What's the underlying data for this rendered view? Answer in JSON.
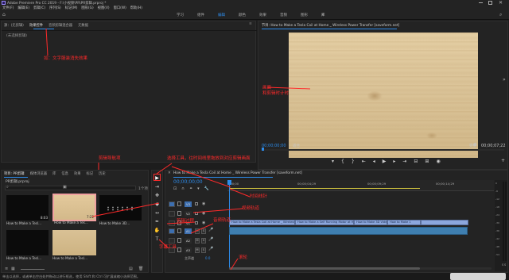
{
  "title_bar": {
    "title": "Adobe Premiere Pro CC 2019 - F:\\小视频\\PR\\PR剪辑.prproj *"
  },
  "menu_bar": {
    "items": [
      "文件(F)",
      "编辑(E)",
      "剪辑(C)",
      "序列(S)",
      "标记(M)",
      "图形(G)",
      "视图(V)",
      "窗口(W)",
      "帮助(H)"
    ]
  },
  "workspaces": {
    "items": [
      "学习",
      "组件",
      "编辑",
      "颜色",
      "效果",
      "音频",
      "图形",
      "库"
    ],
    "active_index": 2
  },
  "source_panel": {
    "tabs": [
      "源：(无剪辑)",
      "效果控件",
      "音频剪辑混合器",
      "元数据"
    ],
    "message": "(未选择剪辑)"
  },
  "program_monitor": {
    "title": "节目: How to Make a Tesla Coil at Home _ Wireless Power Transfer [saveform.net]",
    "timecode_left": "00;00;00;00",
    "fit_label": "适合",
    "quality_label": "完整",
    "timecode_right": "00;00;07;22"
  },
  "project_panel": {
    "tabs": [
      "项目: PR剪辑",
      "媒体浏览器",
      "库",
      "信息",
      "效果",
      "标记",
      "历史"
    ],
    "file_name": "PR剪辑.prproj",
    "item_count": "1个项",
    "items": [
      {
        "name": "How to Make a Tesl...",
        "duration": "8:03"
      },
      {
        "name": "How to Make a Tes...",
        "duration": "7:22"
      },
      {
        "name": "How to Make 3D...",
        "duration": ""
      },
      {
        "name": "How to Make a Tesl...",
        "duration": ""
      },
      {
        "name": "How to Make a Tesl...",
        "duration": ""
      }
    ]
  },
  "timeline": {
    "sequence_tab": "How to Make a Tesla Coil at Home _ Wireless Power Transfer [saveform.net]",
    "timecode": "00;00;00;00",
    "ruler_labels": [
      ":00;00",
      "00;00;04;29",
      "00;00;09;29",
      "00;00;14;29"
    ],
    "video_tracks": [
      "V3",
      "V2",
      "V1"
    ],
    "audio_tracks": [
      "A1",
      "A2",
      "A3"
    ],
    "master_label": "主声道",
    "master_value": "0.0",
    "clips": [
      "How to Make a Tesla Coil at Home _ Wireless Power Transfer [saveform.net].mp4 [V]",
      "How to Make a Self Running Motor at Home",
      "How to Make 3D Video",
      "How to Make 1"
    ],
    "meter_labels": [
      "0",
      "-6",
      "-12",
      "-18",
      "-24",
      "-30",
      "-36",
      "-42",
      "-48",
      "-54"
    ],
    "meter_footer": [
      "S",
      "S"
    ]
  },
  "annotations": {
    "effects_hint": "如：文字服装消失效果",
    "preview_hint": "画面\n和剪辑时计时",
    "project_hint": "剪辑导航项",
    "tools_hint": "选择工具，往时间线里拖放到对应剪辑画面",
    "seq_hint": "剪辑画面",
    "timeline_hint": "时间线针",
    "video_track_hint": "视频轨道",
    "audio_track_hint": "音频轨道",
    "text_tool_hint": "字幕工具",
    "track_select_hint": "剪辑过程",
    "scroll_hint": "滚轮"
  },
  "status_bar": {
    "text": "单击以选择，或者单击空白处并拖动以进行框选，使用 Shift 和 Ctrl 可扩展或缩小选择范围。"
  },
  "colors": {
    "accent": "#2d8ceb",
    "annotation": "#ff2a2a",
    "clip_video": "#8ca7dd",
    "clip_audio": "#3f7fb0"
  }
}
